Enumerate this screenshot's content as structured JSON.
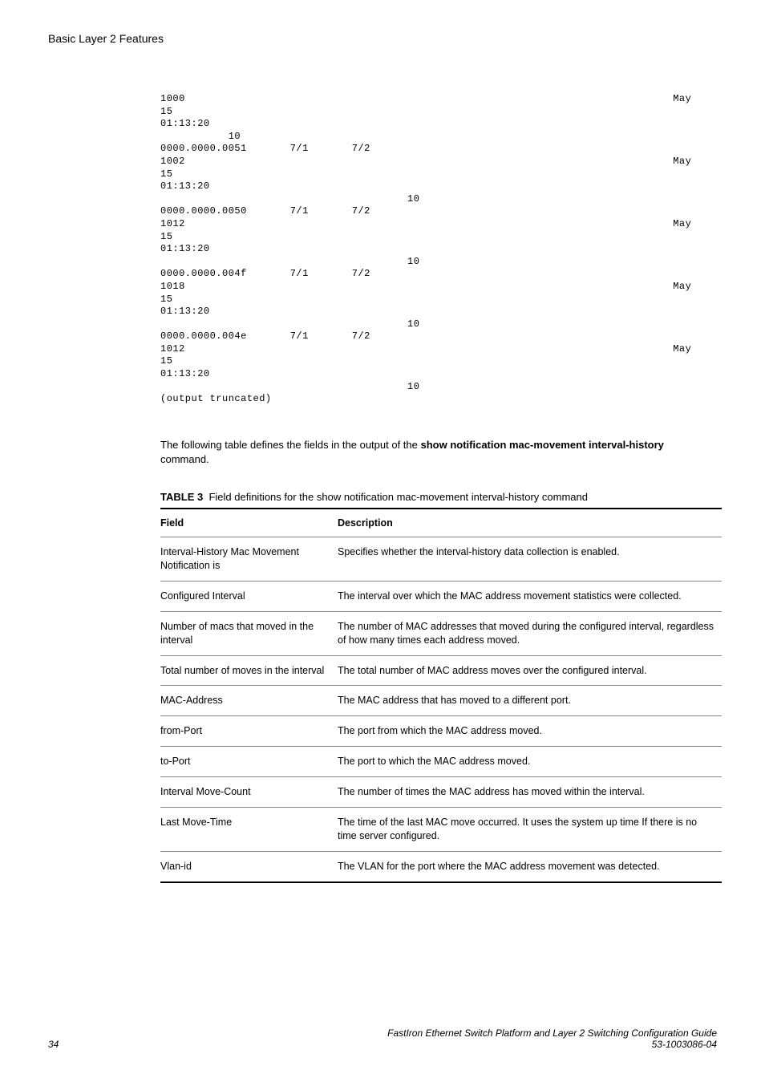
{
  "header": {
    "title": "Basic Layer 2 Features"
  },
  "code_output": "1000                                                                               May\n15\n01:13:20\n           10\n0000.0000.0051       7/1       7/2\n1002                                                                               May\n15\n01:13:20\n                                        10\n0000.0000.0050       7/1       7/2\n1012                                                                               May\n15\n01:13:20\n                                        10\n0000.0000.004f       7/1       7/2\n1018                                                                               May\n15\n01:13:20\n                                        10\n0000.0000.004e       7/1       7/2\n1012                                                                               May\n15\n01:13:20\n                                        10\n(output truncated)",
  "paragraph": {
    "pre": "The following table defines the fields in the output of the ",
    "bold": "show notification mac-movement interval-history",
    "post": " command."
  },
  "table": {
    "caption_label": "TABLE 3",
    "caption_text": "Field definitions for the show notification mac-movement interval-history command",
    "headers": {
      "field": "Field",
      "description": "Description"
    },
    "rows": [
      {
        "field": "Interval-History Mac Movement Notification is",
        "description": "Specifies whether the interval-history data collection is enabled."
      },
      {
        "field": "Configured Interval",
        "description": "The interval over which the MAC address movement statistics were collected."
      },
      {
        "field": "Number of macs that moved in the interval",
        "description": "The number of MAC addresses that moved during the configured interval, regardless of how many times each address moved."
      },
      {
        "field": "Total number of moves in the interval",
        "description": "The total number of MAC address moves over the configured interval."
      },
      {
        "field": "MAC-Address",
        "description": "The MAC address that has moved to a different port."
      },
      {
        "field": "from-Port",
        "description": "The port from which the MAC address moved."
      },
      {
        "field": "to-Port",
        "description": "The port to which the MAC address moved."
      },
      {
        "field": "Interval Move-Count",
        "description": "The number of times the MAC address has moved within the interval."
      },
      {
        "field": "Last Move-Time",
        "description": "The time of the last MAC move occurred. It uses the system up time If there is no time server configured."
      },
      {
        "field": "Vlan-id",
        "description": "The VLAN for the port where the MAC address movement was detected."
      }
    ]
  },
  "footer": {
    "page": "34",
    "title": "FastIron Ethernet Switch Platform and Layer 2 Switching Configuration Guide",
    "docnum": "53-1003086-04"
  }
}
